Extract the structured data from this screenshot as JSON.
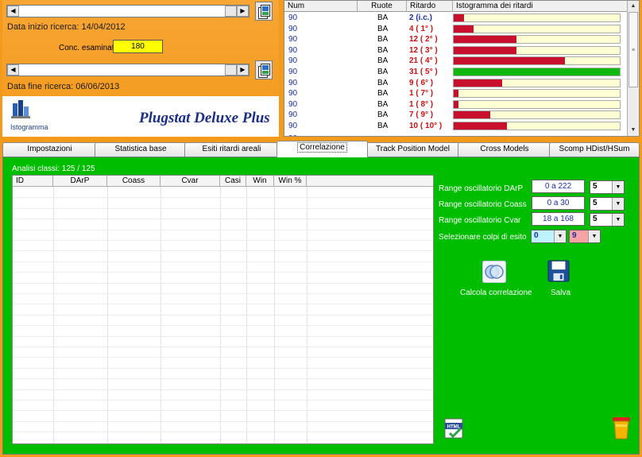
{
  "top_panel": {
    "date_start_label": "Data inizio ricerca: 14/04/2012",
    "conc_label": "Conc. esaminati",
    "conc_value": "180",
    "date_end_label": "Data fine ricerca: 06/06/2013",
    "app_title": "Plugstat Deluxe Plus",
    "histogram_label": "Istogramma"
  },
  "grid": {
    "columns": [
      "Num",
      "Ruote",
      "Ritardo",
      "Istogramma dei ritardi"
    ],
    "rows": [
      {
        "num": "90",
        "ruote": "BA",
        "ritardo": "2  (i.c.)",
        "bar": 0.06,
        "color": "#c8102e",
        "rit_color": "#1a2db0"
      },
      {
        "num": "90",
        "ruote": "BA",
        "ritardo": "4  ( 1° )",
        "bar": 0.12,
        "color": "#c8102e",
        "rit_color": "#d01010"
      },
      {
        "num": "90",
        "ruote": "BA",
        "ritardo": "12  ( 2° )",
        "bar": 0.38,
        "color": "#c8102e",
        "rit_color": "#d01010"
      },
      {
        "num": "90",
        "ruote": "BA",
        "ritardo": "12  ( 3° )",
        "bar": 0.38,
        "color": "#c8102e",
        "rit_color": "#d01010"
      },
      {
        "num": "90",
        "ruote": "BA",
        "ritardo": "21  ( 4° )",
        "bar": 0.67,
        "color": "#c8102e",
        "rit_color": "#d01010"
      },
      {
        "num": "90",
        "ruote": "BA",
        "ritardo": "31  ( 5° )",
        "bar": 1.0,
        "color": "#0fb80f",
        "rit_color": "#d01010"
      },
      {
        "num": "90",
        "ruote": "BA",
        "ritardo": "9  ( 6° )",
        "bar": 0.29,
        "color": "#c8102e",
        "rit_color": "#d01010"
      },
      {
        "num": "90",
        "ruote": "BA",
        "ritardo": "1  ( 7° )",
        "bar": 0.03,
        "color": "#c8102e",
        "rit_color": "#d01010"
      },
      {
        "num": "90",
        "ruote": "BA",
        "ritardo": "1  ( 8° )",
        "bar": 0.03,
        "color": "#c8102e",
        "rit_color": "#d01010"
      },
      {
        "num": "90",
        "ruote": "BA",
        "ritardo": "7  ( 9° )",
        "bar": 0.22,
        "color": "#c8102e",
        "rit_color": "#d01010"
      },
      {
        "num": "90",
        "ruote": "BA",
        "ritardo": "10  ( 10° )",
        "bar": 0.32,
        "color": "#c8102e",
        "rit_color": "#d01010"
      }
    ]
  },
  "tabs": [
    {
      "label": "Impostazioni",
      "active": false
    },
    {
      "label": "Statistica base",
      "active": false
    },
    {
      "label": "Esiti ritardi areali",
      "active": false
    },
    {
      "label": "Correlazione",
      "active": true
    },
    {
      "label": "Track Position Model",
      "active": false
    },
    {
      "label": "Cross Models",
      "active": false
    },
    {
      "label": "Scomp HDist/HSum",
      "active": false
    }
  ],
  "main": {
    "analisi_label": "Analisi classi: 125 / 125",
    "table_columns": [
      "ID",
      "DArP",
      "Coass",
      "Cvar",
      "Casi",
      "Win",
      "Win %"
    ],
    "range_darp_label": "Range oscillatorio DArP",
    "range_darp_value": "0 a 222",
    "range_darp_select": "5",
    "range_coass_label": "Range oscillatorio Coass",
    "range_coass_value": "0 a 30",
    "range_coass_select": "5",
    "range_cvar_label": "Range oscillatorio Cvar",
    "range_cvar_value": "18 a 168",
    "range_cvar_select": "5",
    "colpi_label": "Selezionare colpi di esito",
    "colpi_from": "0",
    "colpi_to": "9",
    "calcola_label": "Calcola correlazione",
    "salva_label": "Salva",
    "html_icon_text": "HTML"
  }
}
